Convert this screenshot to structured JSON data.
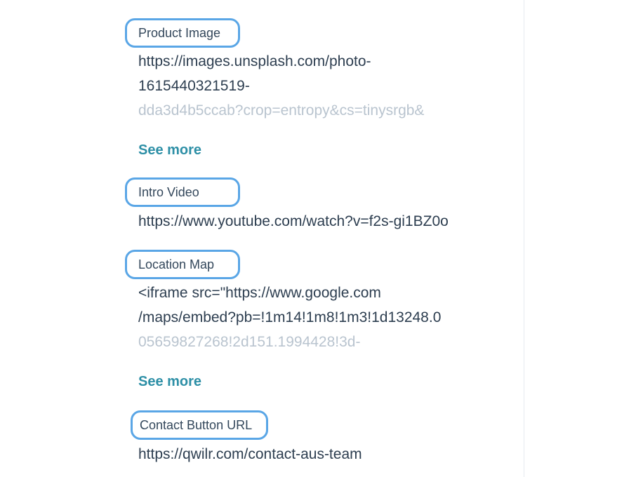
{
  "fields": [
    {
      "label": "Product Image",
      "lines": [
        "https://images.unsplash.com/photo-",
        "1615440321519-",
        "dda3d4b5ccab?crop=entropy&cs=tinysrgb&"
      ],
      "see_more": "See more"
    },
    {
      "label": "Intro Video",
      "lines": [
        "https://www.youtube.com/watch?v=f2s-gi1BZ0o"
      ]
    },
    {
      "label": "Location Map",
      "lines": [
        "<iframe src=\"https://www.google.com",
        "/maps/embed?pb=!1m14!1m8!1m3!1d13248.0",
        "05659827268!2d151.1994428!3d-"
      ],
      "see_more": "See more"
    },
    {
      "label": "Contact Button URL",
      "lines": [
        "https://qwilr.com/contact-aus-team"
      ]
    }
  ],
  "colors": {
    "label_outline": "#5aa6e6",
    "link": "#2d8fa6",
    "text": "#2d3e50",
    "faded_text": "#b9c4cf",
    "divider": "#e6eaf0"
  }
}
